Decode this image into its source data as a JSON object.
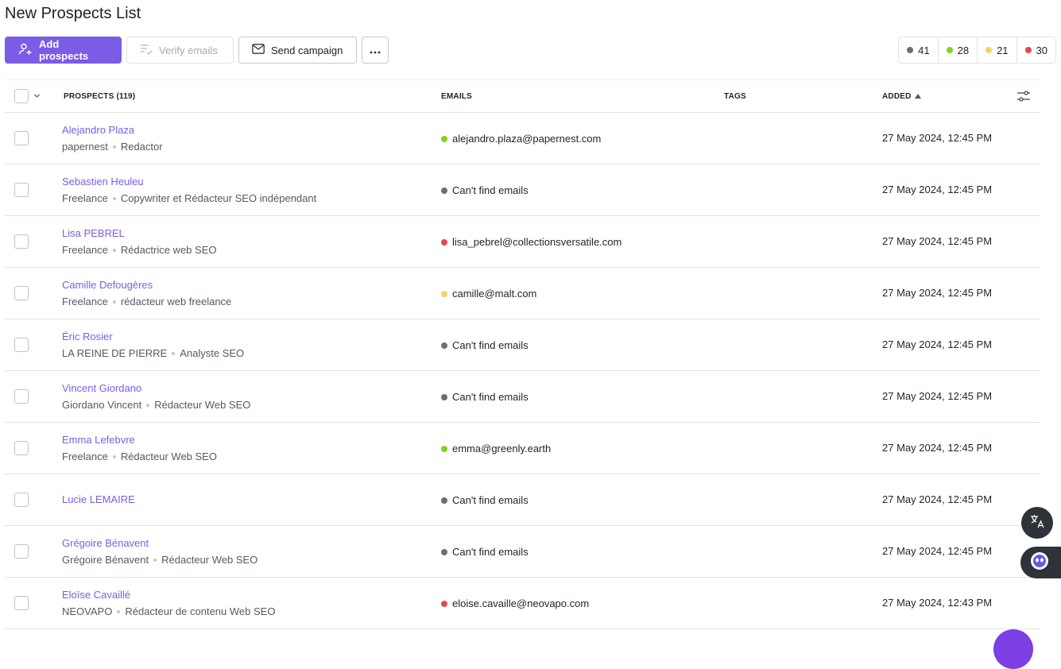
{
  "page": {
    "title": "New Prospects List"
  },
  "toolbar": {
    "add_label": "Add prospects",
    "verify_label": "Verify emails",
    "campaign_label": "Send campaign",
    "more_icon": "ellipsis-icon"
  },
  "counters": [
    {
      "value": "41",
      "color": "#6b6e75"
    },
    {
      "value": "28",
      "color": "#7ed321"
    },
    {
      "value": "21",
      "color": "#f5d26b"
    },
    {
      "value": "30",
      "color": "#e5484d"
    }
  ],
  "table": {
    "headers": {
      "prospects": "PROSPECTS (119)",
      "emails": "EMAILS",
      "tags": "TAGS",
      "added": "ADDED"
    },
    "rows": [
      {
        "name": "Alejandro Plaza",
        "company": "papernest",
        "role": "Redactor",
        "email": "alejandro.plaza@papernest.com",
        "status_color": "#7ed321",
        "added": "27 May 2024, 12:45 PM"
      },
      {
        "name": "Sebastien Heuleu",
        "company": "Freelance",
        "role": "Copywriter et Rédacteur SEO indépendant",
        "email": "Can't find emails",
        "status_color": "#6b6e75",
        "added": "27 May 2024, 12:45 PM"
      },
      {
        "name": "Lisa PEBREL",
        "company": "Freelance",
        "role": "Rédactrice web SEO",
        "email": "lisa_pebrel@collectionsversatile.com",
        "status_color": "#e5484d",
        "added": "27 May 2024, 12:45 PM"
      },
      {
        "name": "Camille Defougères",
        "company": "Freelance",
        "role": "rédacteur web freelance",
        "email": "camille@malt.com",
        "status_color": "#f5d26b",
        "added": "27 May 2024, 12:45 PM"
      },
      {
        "name": "Éric Rosier",
        "company": "LA REINE DE PIERRE",
        "role": "Analyste SEO",
        "email": "Can't find emails",
        "status_color": "#6b6e75",
        "added": "27 May 2024, 12:45 PM"
      },
      {
        "name": "Vincent Giordano",
        "company": "Giordano Vincent",
        "role": "Rédacteur Web SEO",
        "email": "Can't find emails",
        "status_color": "#6b6e75",
        "added": "27 May 2024, 12:45 PM"
      },
      {
        "name": "Emma Lefebvre",
        "company": "Freelance",
        "role": "Rédacteur Web SEO",
        "email": "emma@greenly.earth",
        "status_color": "#7ed321",
        "added": "27 May 2024, 12:45 PM"
      },
      {
        "name": "Lucie LEMAIRE",
        "company": "",
        "role": "",
        "email": "Can't find emails",
        "status_color": "#6b6e75",
        "added": "27 May 2024, 12:45 PM"
      },
      {
        "name": "Grégoire Bénavent",
        "company": "Grégoire Bénavent",
        "role": "Rédacteur Web SEO",
        "email": "Can't find emails",
        "status_color": "#6b6e75",
        "added": "27 May 2024, 12:45 PM"
      },
      {
        "name": "Eloïse Cavaillé",
        "company": "NEOVAPO",
        "role": "Rédacteur de contenu Web SEO",
        "email": "eloise.cavaille@neovapo.com",
        "status_color": "#e5484d",
        "added": "27 May 2024, 12:43 PM"
      }
    ]
  }
}
